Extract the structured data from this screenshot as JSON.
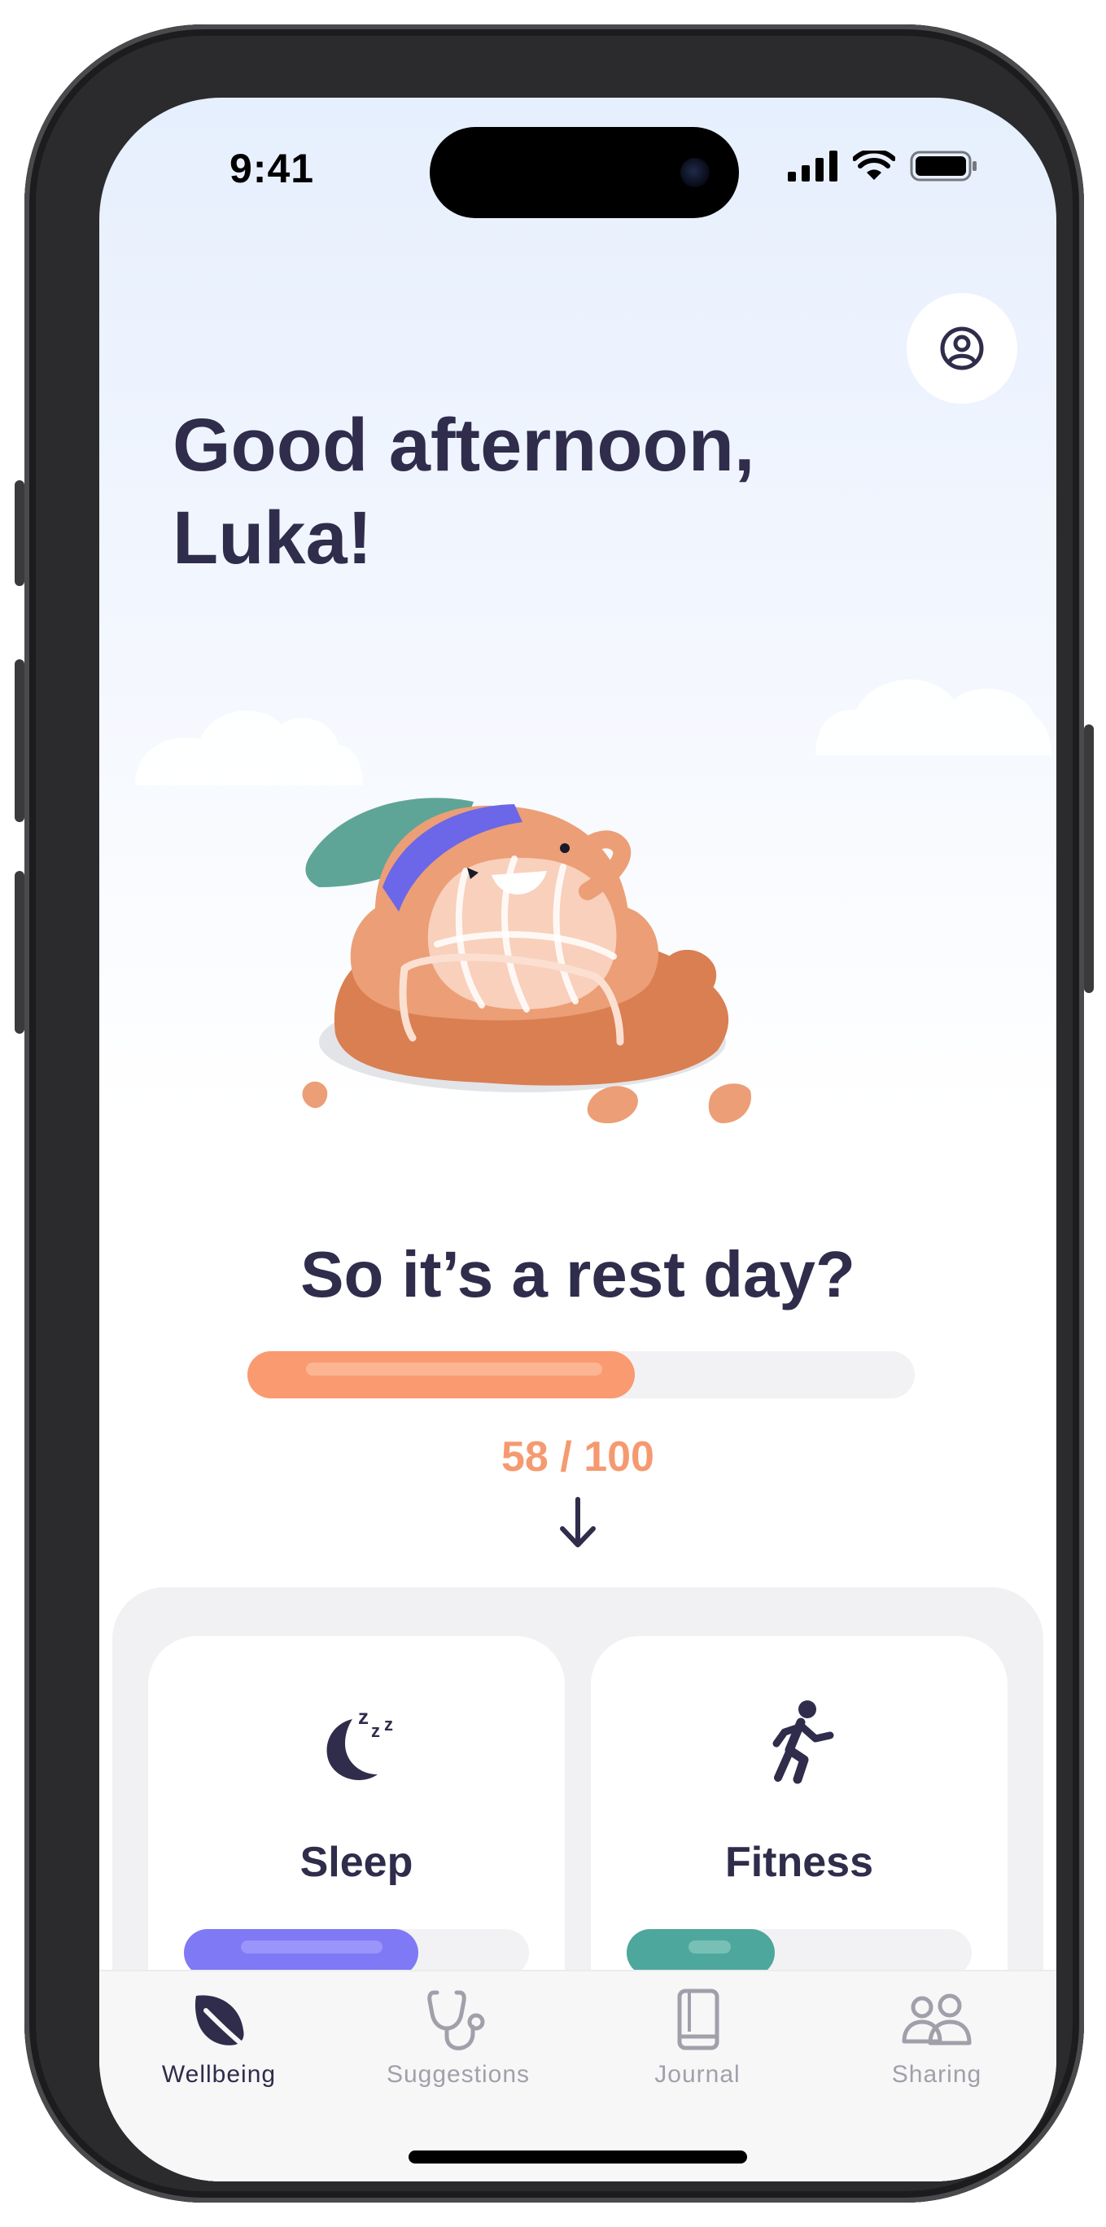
{
  "status_bar": {
    "time": "9:41",
    "icons": [
      "signal-icon",
      "wifi-icon",
      "battery-icon"
    ]
  },
  "header": {
    "profile_icon": "user-circle-icon",
    "greeting_line1": "Good afternoon,",
    "greeting_line2": "Luka!"
  },
  "illustration": {
    "name": "resting-peach-mascot"
  },
  "score": {
    "headline": "So it’s a rest day?",
    "value": 58,
    "max": 100,
    "text": "58 / 100",
    "color": "#fa9a70"
  },
  "scroll_hint_icon": "arrow-down-icon",
  "cards": [
    {
      "label": "Sleep",
      "icon": "sleep-moon-icon",
      "progress": 0.68,
      "color": "#7f79f6"
    },
    {
      "label": "Fitness",
      "icon": "running-person-icon",
      "progress": 0.43,
      "color": "#4ea79c"
    }
  ],
  "tab_bar": {
    "tabs": [
      {
        "label": "Wellbeing",
        "icon": "leaf-icon",
        "active": true
      },
      {
        "label": "Suggestions",
        "icon": "stethoscope-icon",
        "active": false
      },
      {
        "label": "Journal",
        "icon": "book-icon",
        "active": false
      },
      {
        "label": "Sharing",
        "icon": "people-icon",
        "active": false
      }
    ]
  },
  "colors": {
    "text_primary": "#2f2d4b",
    "accent_orange": "#fa9a70",
    "inactive_tab": "#a1a0aa"
  }
}
